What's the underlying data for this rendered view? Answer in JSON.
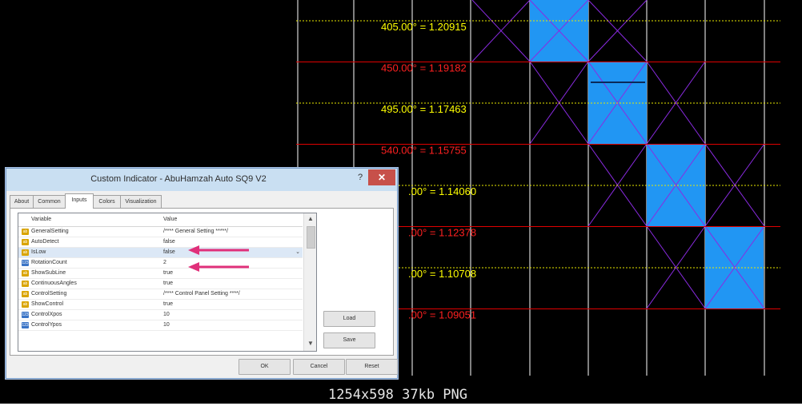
{
  "caption": "1254x598 37kb PNG",
  "chart": {
    "levels": [
      {
        "label": "405.00° = 1.20915",
        "color": "#ffff00"
      },
      {
        "label": "450.00° = 1.19182",
        "color": "#ff2020"
      },
      {
        "label": "495.00° = 1.17463",
        "color": "#ffff00"
      },
      {
        "label": "540.00° = 1.15755",
        "color": "#ff2020"
      },
      {
        "label": ".00° = 1.14060",
        "color": "#ffff00"
      },
      {
        "label": ".00° = 1.12378",
        "color": "#ff2020"
      },
      {
        "label": ".00° = 1.10708",
        "color": "#ffff00"
      },
      {
        "label": ".00° = 1.09051",
        "color": "#ff2020"
      }
    ],
    "colors": {
      "box_fill": "#2196f3",
      "cross": "#8a2be2",
      "red_line": "#e00000",
      "yellow_dash": "#e8e800",
      "vline": "#ffffff"
    }
  },
  "dialog": {
    "title": "Custom Indicator - AbuHamzah Auto SQ9 V2",
    "help": "?",
    "close": "✕",
    "tabs": [
      "About",
      "Common",
      "Inputs",
      "Colors",
      "Visualization"
    ],
    "active_tab": "Inputs",
    "columns": {
      "variable": "Variable",
      "value": "Value"
    },
    "rows": [
      {
        "icon": "ab",
        "name": "GeneralSetting",
        "value": "/**** General Setting *****/"
      },
      {
        "icon": "ab",
        "name": "AutoDetect",
        "value": "false"
      },
      {
        "icon": "ab",
        "name": "IsLow",
        "value": "false"
      },
      {
        "icon": "123",
        "name": "RotationCount",
        "value": "2"
      },
      {
        "icon": "ab",
        "name": "ShowSubLine",
        "value": "true"
      },
      {
        "icon": "ab",
        "name": "ContinuousAngles",
        "value": "true"
      },
      {
        "icon": "ab",
        "name": "ControlSetting",
        "value": "/**** Control Panel Setting ****/"
      },
      {
        "icon": "ab",
        "name": "ShowControl",
        "value": "true"
      },
      {
        "icon": "123",
        "name": "ControlXpos",
        "value": "10"
      },
      {
        "icon": "123",
        "name": "ControlYpos",
        "value": "10"
      }
    ],
    "buttons": {
      "load": "Load",
      "save": "Save",
      "ok": "OK",
      "cancel": "Cancel",
      "reset": "Reset"
    },
    "arrow_color": "#e0307a"
  }
}
